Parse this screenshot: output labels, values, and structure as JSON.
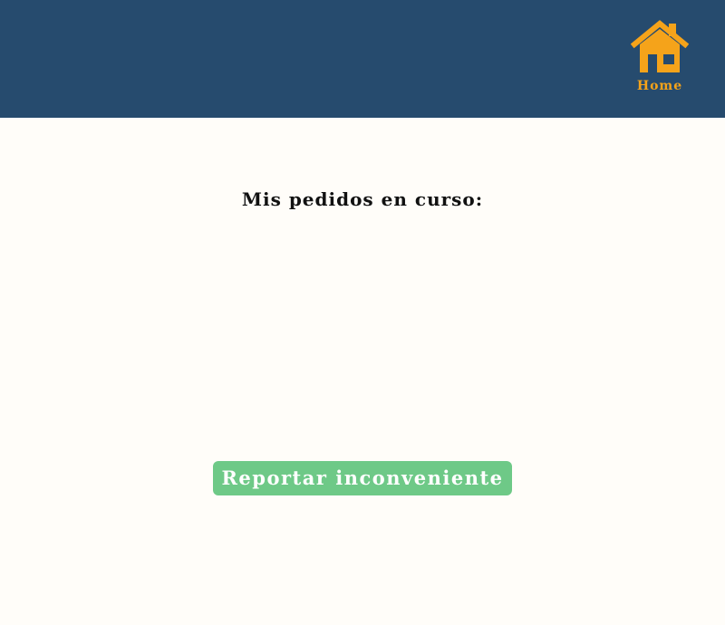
{
  "header": {
    "background_color": "#264b6e",
    "home": {
      "icon": "home-icon",
      "label": "Home",
      "color": "#f5a31a"
    }
  },
  "main": {
    "title": "Mis pedidos en curso:",
    "orders": [],
    "report_button": {
      "label": "Reportar inconveniente",
      "color": "#6ec987"
    }
  }
}
